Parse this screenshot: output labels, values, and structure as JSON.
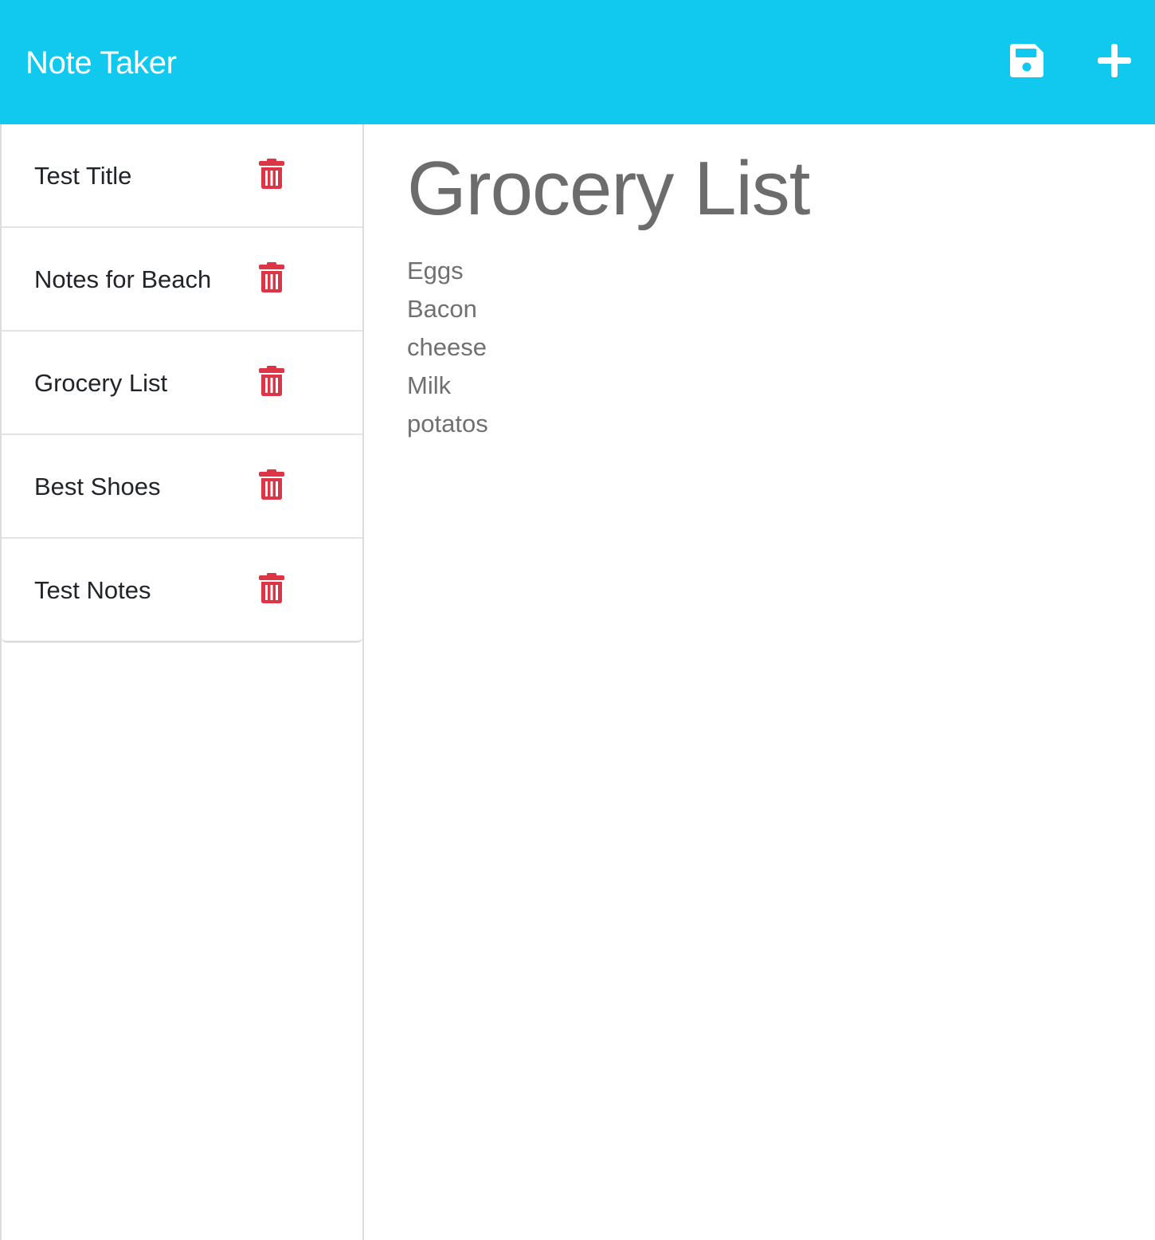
{
  "app": {
    "title": "Note Taker"
  },
  "header": {
    "save_icon": "floppy-disk-icon",
    "new_icon": "plus-icon",
    "icon_color": "#ffffff",
    "bar_color": "#11c9ef"
  },
  "sidebar": {
    "delete_icon": "trash-icon",
    "delete_color": "#dc3545",
    "notes": [
      {
        "title": "Test Title"
      },
      {
        "title": "Notes for Beach"
      },
      {
        "title": "Grocery List"
      },
      {
        "title": "Best Shoes"
      },
      {
        "title": "Test Notes"
      }
    ]
  },
  "active_note": {
    "title": "Grocery List",
    "lines": [
      "Eggs",
      "Bacon",
      "cheese",
      "Milk",
      "potatos"
    ]
  }
}
